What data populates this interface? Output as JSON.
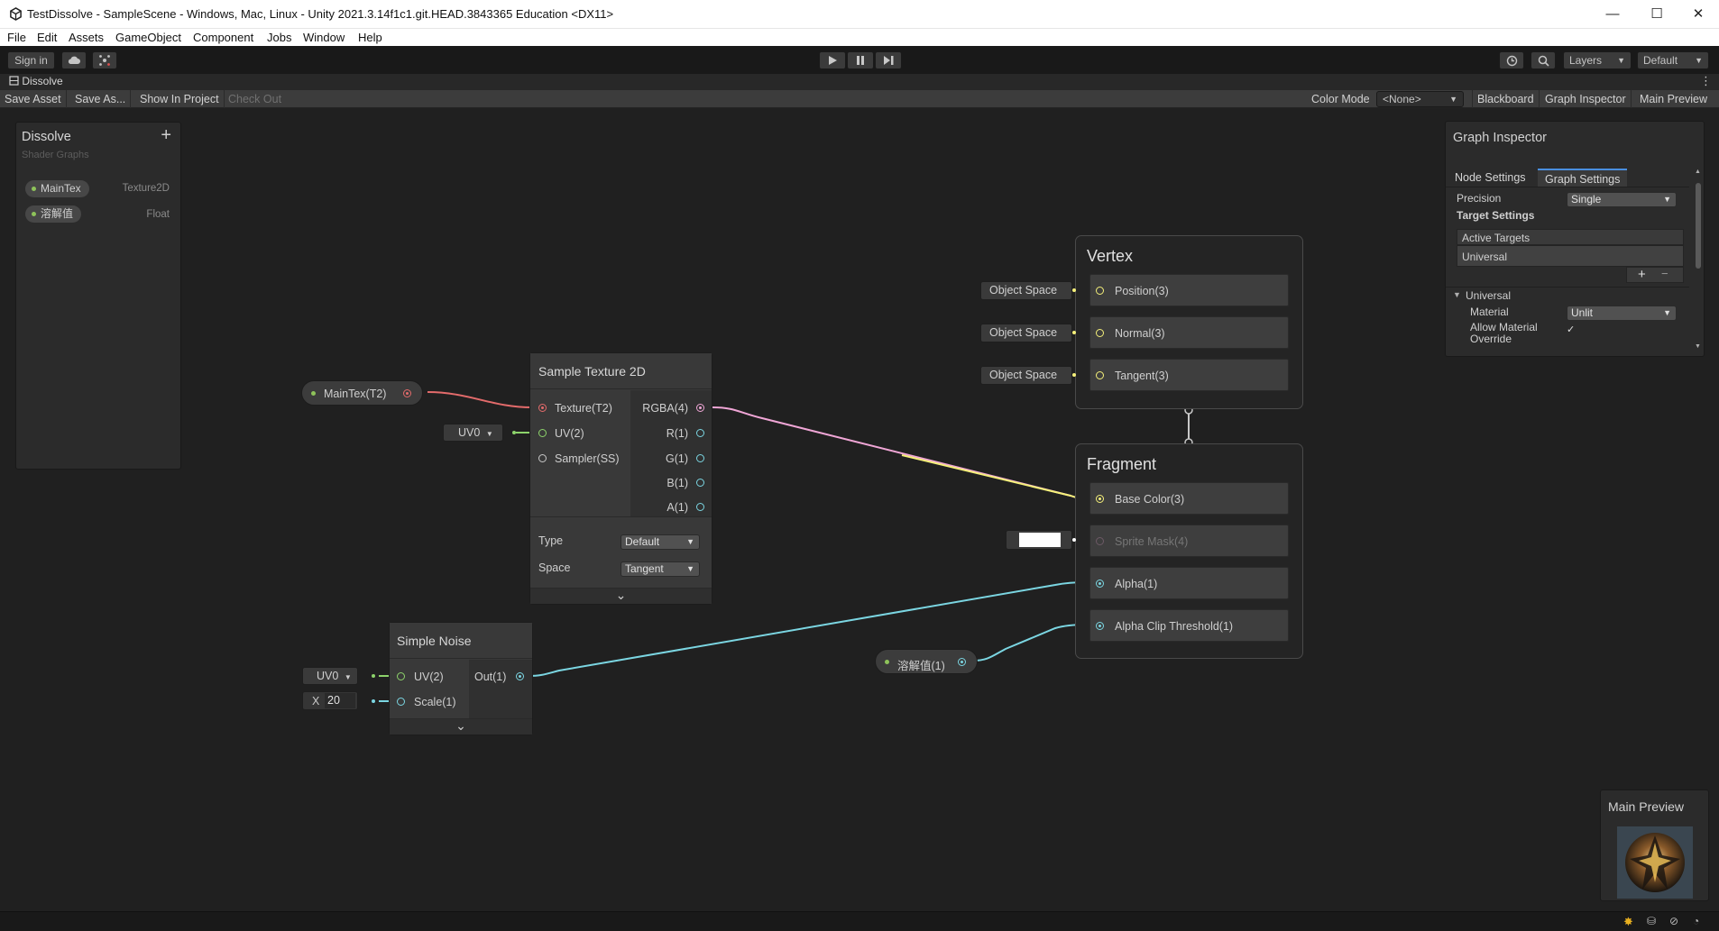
{
  "window": {
    "title": "TestDissolve - SampleScene - Windows, Mac, Linux - Unity 2021.3.14f1c1.git.HEAD.3843365 Education <DX11>",
    "minimize_glyph": "—",
    "maximize_glyph": "☐",
    "close_glyph": "✕"
  },
  "menu": [
    "File",
    "Edit",
    "Assets",
    "GameObject",
    "Component",
    "Jobs",
    "Window",
    "Help"
  ],
  "toolbar": {
    "sign_in": "Sign in",
    "layers": "Layers",
    "layout": "Default"
  },
  "tab": {
    "label": "Dissolve"
  },
  "graph_toolbar": {
    "save_asset": "Save Asset",
    "save_as": "Save As...",
    "show_in_project": "Show In Project",
    "check_out": "Check Out",
    "color_mode_label": "Color Mode",
    "color_mode_value": "<None>",
    "blackboard": "Blackboard",
    "graph_inspector": "Graph Inspector",
    "main_preview": "Main Preview"
  },
  "blackboard": {
    "title": "Dissolve",
    "subtitle": "Shader Graphs",
    "add": "+",
    "properties": [
      {
        "name": "MainTex",
        "type": "Texture2D"
      },
      {
        "name": "溶解值",
        "type": "Float"
      }
    ]
  },
  "nodes": {
    "maintex_prop": {
      "label": "MainTex(T2)"
    },
    "sample_texture": {
      "title": "Sample Texture 2D",
      "inputs": [
        "Texture(T2)",
        "UV(2)",
        "Sampler(SS)"
      ],
      "outputs": [
        "RGBA(4)",
        "R(1)",
        "G(1)",
        "B(1)",
        "A(1)"
      ],
      "uv_channel": "UV0",
      "type_label": "Type",
      "type_value": "Default",
      "space_label": "Space",
      "space_value": "Tangent",
      "expand": "⌄"
    },
    "simple_noise": {
      "title": "Simple Noise",
      "inputs": [
        "UV(2)",
        "Scale(1)"
      ],
      "output": "Out(1)",
      "uv_channel": "UV0",
      "scale_axis": "X",
      "scale_value": "20",
      "expand": "⌄"
    },
    "dissolve_prop": {
      "label": "溶解值(1)"
    },
    "vertex": {
      "title": "Vertex",
      "slots": [
        "Position(3)",
        "Normal(3)",
        "Tangent(3)"
      ],
      "space_fields": [
        "Object Space",
        "Object Space",
        "Object Space"
      ]
    },
    "fragment": {
      "title": "Fragment",
      "slots": [
        "Base Color(3)",
        "Sprite Mask(4)",
        "Alpha(1)",
        "Alpha Clip Threshold(1)"
      ]
    }
  },
  "inspector": {
    "title": "Graph Inspector",
    "tabs": [
      "Node Settings",
      "Graph Settings"
    ],
    "active_tab": "Graph Settings",
    "precision_label": "Precision",
    "precision_value": "Single",
    "target_settings": "Target Settings",
    "active_targets": "Active Targets",
    "target_item": "Universal",
    "add": "+",
    "remove": "−",
    "section": "Universal",
    "material_label": "Material",
    "material_value": "Unlit",
    "allow_override_label": "Allow Material Override",
    "allow_override_checked": "✓"
  },
  "preview": {
    "title": "Main Preview"
  },
  "colors": {
    "texture_port": "#e36b6b",
    "vector2_port": "#8dd36b",
    "vector4_port": "#f0a6d6",
    "float_port": "#7bd6e2",
    "vector3_port": "#f5f07a",
    "sampler_port": "#c8c8c8"
  }
}
